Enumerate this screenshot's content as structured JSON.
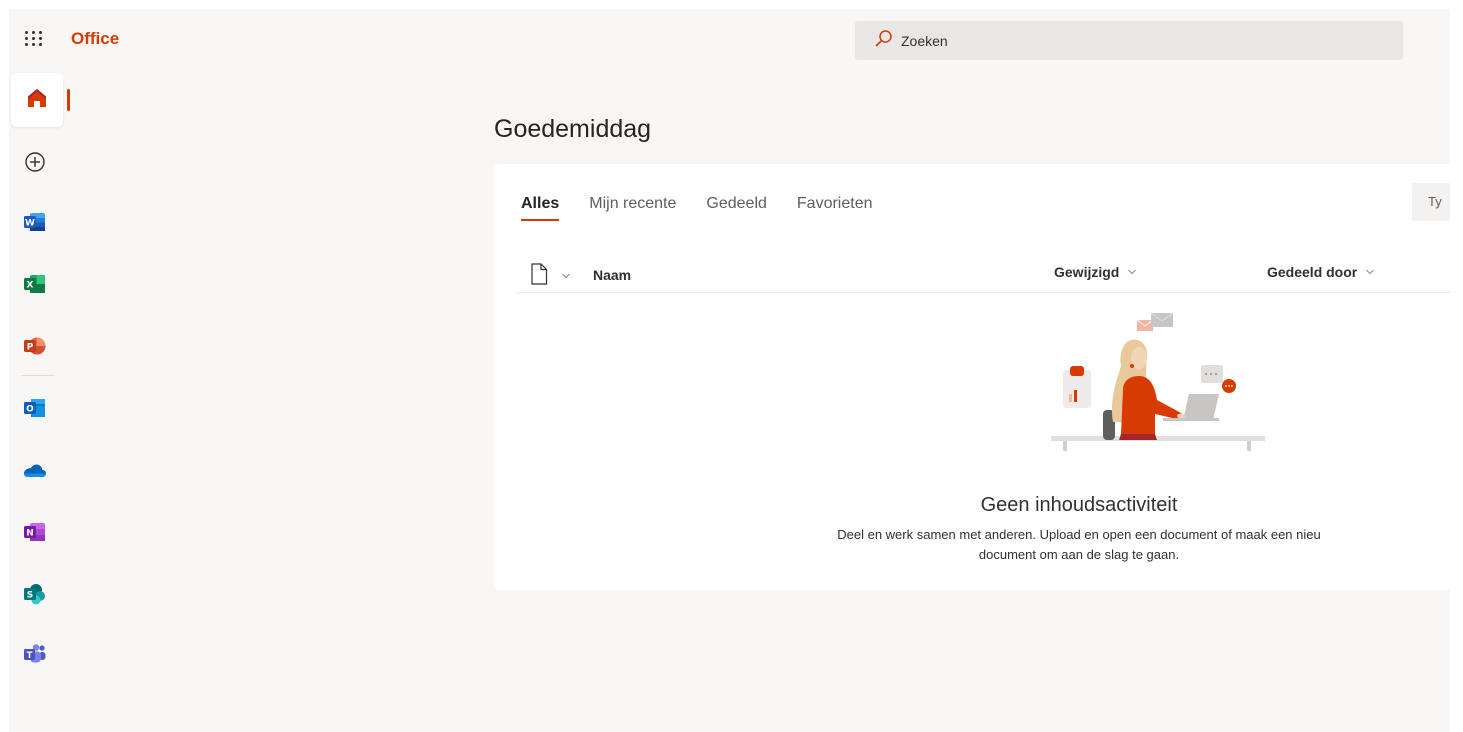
{
  "header": {
    "app_name": "Office",
    "search_placeholder": "Zoeken"
  },
  "rail": {
    "items": [
      {
        "name": "Home",
        "icon": "home-icon"
      },
      {
        "name": "Maken",
        "icon": "plus-circle-icon"
      },
      {
        "name": "Word",
        "icon": "word-icon",
        "letter": "W",
        "color": "#2b579a"
      },
      {
        "name": "Excel",
        "icon": "excel-icon",
        "letter": "X",
        "color": "#217346"
      },
      {
        "name": "PowerPoint",
        "icon": "powerpoint-icon",
        "letter": "P",
        "color": "#d24726"
      },
      {
        "name": "Outlook",
        "icon": "outlook-icon",
        "letter": "O",
        "color": "#0078d4"
      },
      {
        "name": "OneDrive",
        "icon": "onedrive-icon",
        "color": "#0364b8"
      },
      {
        "name": "OneNote",
        "icon": "onenote-icon",
        "letter": "N",
        "color": "#7719aa"
      },
      {
        "name": "SharePoint",
        "icon": "sharepoint-icon",
        "letter": "S",
        "color": "#038387"
      },
      {
        "name": "Teams",
        "icon": "teams-icon",
        "letter": "T",
        "color": "#5059c9"
      }
    ]
  },
  "main": {
    "greeting": "Goedemiddag",
    "tabs": [
      {
        "label": "Alles",
        "active": true
      },
      {
        "label": "Mijn recente",
        "active": false
      },
      {
        "label": "Gedeeld",
        "active": false
      },
      {
        "label": "Favorieten",
        "active": false
      }
    ],
    "filter_placeholder": "Ty",
    "columns": {
      "name": "Naam",
      "modified": "Gewijzigd",
      "shared_by": "Gedeeld door"
    },
    "empty_state": {
      "title": "Geen inhoudsactiviteit",
      "line1": "Deel en werk samen met anderen. Upload en open een document of maak een nieu",
      "line2": "document om aan de slag te gaan."
    }
  },
  "colors": {
    "accent": "#d83b01",
    "background": "#f8f7f6",
    "card": "#ffffff",
    "search": "#e8e7e6"
  }
}
